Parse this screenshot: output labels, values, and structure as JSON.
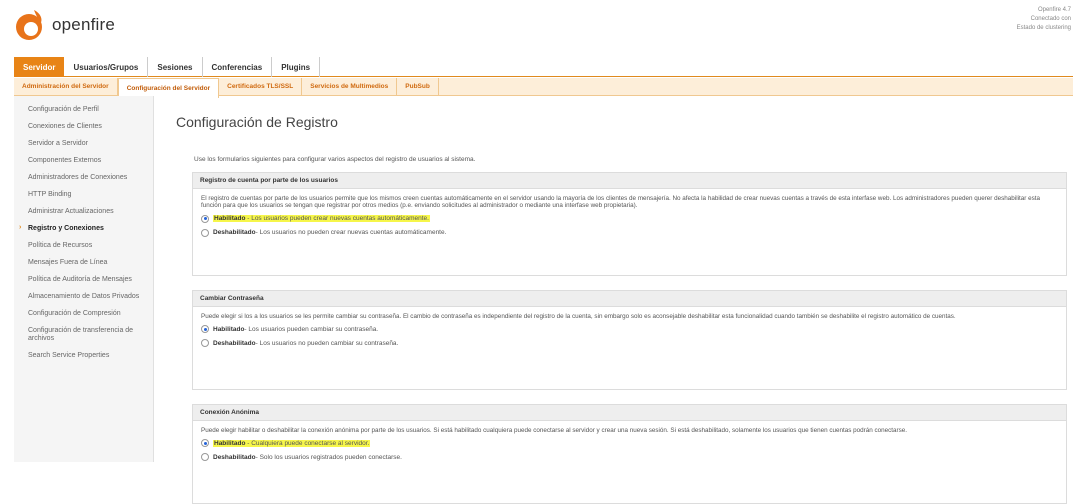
{
  "header": {
    "app_name": "openfire",
    "info_lines": [
      "Openfire 4.7",
      "Conectado con",
      "Estado de clustering"
    ]
  },
  "top_tabs": [
    {
      "label": "Servidor",
      "active": true
    },
    {
      "label": "Usuarios/Grupos",
      "active": false
    },
    {
      "label": "Sesiones",
      "active": false
    },
    {
      "label": "Conferencias",
      "active": false
    },
    {
      "label": "Plugins",
      "active": false
    }
  ],
  "sub_tabs": [
    {
      "label": "Administración del Servidor",
      "active": false
    },
    {
      "label": "Configuración del Servidor",
      "active": true
    },
    {
      "label": "Certificados TLS/SSL",
      "active": false
    },
    {
      "label": "Servicios de Multimedios",
      "active": false
    },
    {
      "label": "PubSub",
      "active": false
    }
  ],
  "sidebar": {
    "items": [
      {
        "label": "Configuración de Perfil",
        "active": false
      },
      {
        "label": "Conexiones de Clientes",
        "active": false
      },
      {
        "label": "Servidor a Servidor",
        "active": false
      },
      {
        "label": "Componentes Externos",
        "active": false
      },
      {
        "label": "Administradores de Conexiones",
        "active": false
      },
      {
        "label": "HTTP Binding",
        "active": false
      },
      {
        "label": "Administrar Actualizaciones",
        "active": false
      },
      {
        "label": "Registro y Conexiones",
        "active": true
      },
      {
        "label": "Política de Recursos",
        "active": false
      },
      {
        "label": "Mensajes Fuera de Línea",
        "active": false
      },
      {
        "label": "Política de Auditoría de Mensajes",
        "active": false
      },
      {
        "label": "Almacenamiento de Datos Privados",
        "active": false
      },
      {
        "label": "Configuración de Compresión",
        "active": false
      },
      {
        "label": "Configuración de transferencia de archivos",
        "active": false
      },
      {
        "label": "Search Service Properties",
        "active": false
      }
    ]
  },
  "main": {
    "title": "Configuración de Registro",
    "intro": "Use los formularios siguientes para configurar varios aspectos del registro de usuarios al sistema.",
    "sections": [
      {
        "header": "Registro de cuenta por parte de los usuarios",
        "description": "El registro de cuentas por parte de los usuarios permite que los mismos creen cuentas automáticamente en el servidor usando la mayoría de los clientes de mensajería. No afecta la habilidad de crear nuevas cuentas a través de esta interfase web. Los administradores pueden querer deshabilitar esta función para que los usuarios se tengan que registrar por otros medios (p.e. enviando solicitudes al administrador o mediante una interfase web propietaria).",
        "enabled_label": "Habilitado",
        "enabled_text": " - Los usuarios pueden crear nuevas cuentas automáticamente.",
        "disabled_label": "Deshabilitado",
        "disabled_text": " - Los usuarios no pueden crear nuevas cuentas automáticamente."
      },
      {
        "header": "Cambiar Contraseña",
        "description": "Puede elegir si los a los usuarios se les permite cambiar su contraseña. El cambio de contraseña es independiente del registro de la cuenta, sin embargo solo es aconsejable deshabilitar esta funcionalidad cuando también se deshabilite el registro automático de cuentas.",
        "enabled_label": "Habilitado",
        "enabled_text": " - Los usuarios pueden cambiar su contraseña.",
        "disabled_label": "Deshabilitado",
        "disabled_text": " - Los usuarios no pueden cambiar su contraseña."
      },
      {
        "header": "Conexión Anónima",
        "description": "Puede elegir habilitar o deshabilitar la conexión anónima por parte de los usuarios. Si está habilitado cualquiera puede conectarse al servidor y crear una nueva sesión. Si está deshabilitado, solamente los usuarios que tienen cuentas podrán conectarse.",
        "enabled_label": "Habilitado",
        "enabled_text": " - Cualquiera puede conectarse al servidor.",
        "disabled_label": "Deshabilitado",
        "disabled_text": " - Solo los usuarios registrados pueden conectarse."
      }
    ]
  },
  "colors": {
    "accent": "#e88416",
    "highlight": "#f6f64a",
    "radio_checked": "#2563d8"
  }
}
